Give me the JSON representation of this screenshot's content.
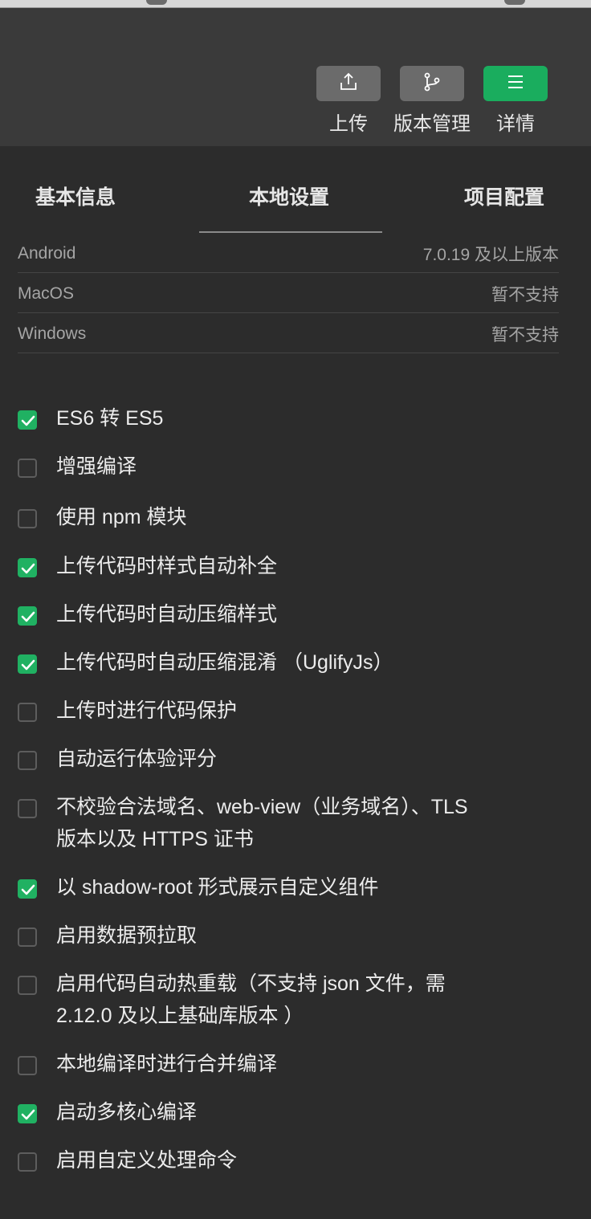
{
  "toolbar": {
    "buttons": [
      {
        "label": "上传",
        "icon": "upload-icon"
      },
      {
        "label": "版本管理",
        "icon": "branch-icon"
      },
      {
        "label": "详情",
        "icon": "menu-icon"
      }
    ],
    "accent": "#1aad5e"
  },
  "tabs": {
    "items": [
      "基本信息",
      "本地设置",
      "项目配置"
    ],
    "active": "本地设置"
  },
  "info": {
    "rows": [
      {
        "label": "Android",
        "value": "7.0.19 及以上版本"
      },
      {
        "label": "MacOS",
        "value": "暂不支持"
      },
      {
        "label": "Windows",
        "value": "暂不支持"
      }
    ]
  },
  "options": [
    {
      "label": "ES6 转 ES5",
      "checked": true
    },
    {
      "label": "增强编译",
      "checked": false
    },
    {
      "label": "使用 npm 模块",
      "checked": false
    },
    {
      "label": "上传代码时样式自动补全",
      "checked": true
    },
    {
      "label": "上传代码时自动压缩样式",
      "checked": true
    },
    {
      "label": "上传代码时自动压缩混淆 （UglifyJs）",
      "checked": true
    },
    {
      "label": "上传时进行代码保护",
      "checked": false
    },
    {
      "label": "自动运行体验评分",
      "checked": false
    },
    {
      "label_line1": "不校验合法域名、web-view（业务域名）、TLS",
      "label_line2": "版本以及 HTTPS 证书",
      "checked": false
    },
    {
      "label": "以 shadow-root 形式展示自定义组件",
      "checked": true
    },
    {
      "label": "启用数据预拉取",
      "checked": false
    },
    {
      "label_line1": "启用代码自动热重载（不支持 json 文件，需",
      "label_line2": "2.12.0 及以上基础库版本 ）",
      "checked": false
    },
    {
      "label": "本地编译时进行合并编译",
      "checked": false
    },
    {
      "label": "启动多核心编译",
      "checked": true
    },
    {
      "label": "启用自定义处理命令",
      "checked": false
    }
  ]
}
